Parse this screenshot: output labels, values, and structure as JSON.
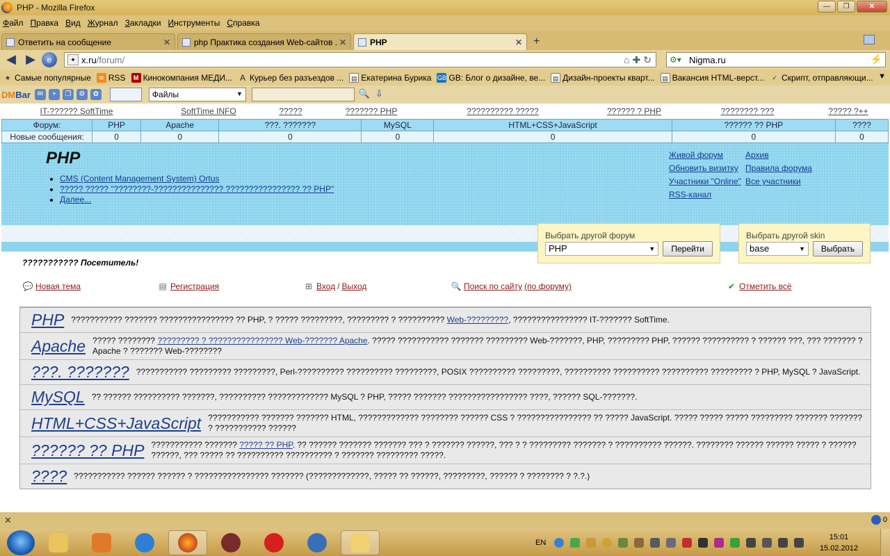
{
  "window": {
    "title": "PHP - Mozilla Firefox",
    "minimize": "—",
    "maximize": "❐",
    "close": "✕"
  },
  "menu": [
    "Файл",
    "Правка",
    "Вид",
    "Журнал",
    "Закладки",
    "Инструменты",
    "Справка"
  ],
  "tabs": [
    {
      "label": "Ответить на сообщение",
      "close": "✕"
    },
    {
      "label": "php Практика создания Web-сайтов ...",
      "close": "✕"
    },
    {
      "label": "PHP",
      "close": "✕"
    }
  ],
  "new_tab": "+",
  "navigation": {
    "back": "◀",
    "forward": "▶",
    "url_host": "x.ru",
    "url_path": "/forum/",
    "search_engine_value": "Nigma.ru"
  },
  "bookmarks": [
    {
      "icon": "star-icon",
      "label": "Самые популярные"
    },
    {
      "icon": "rss-icon",
      "label": "RSS"
    },
    {
      "icon": "m-icon",
      "label": "Кинокомпания МЕДИ..."
    },
    {
      "icon": "a-icon",
      "label": "Курьер без разъездов ..."
    },
    {
      "icon": "page-icon",
      "label": "Екатерина Бурика"
    },
    {
      "icon": "gb-icon",
      "label": "GB: Блог о дизайне, ве..."
    },
    {
      "icon": "page-icon",
      "label": "Дизайн-проекты кварт..."
    },
    {
      "icon": "page-icon",
      "label": "Вакансия HTML-верст..."
    },
    {
      "icon": "star-icon",
      "label": "Скрипт, отправляющи..."
    }
  ],
  "dmbar": {
    "logo_dm": "DM",
    "logo_bar": "Bar",
    "files_select": "Файлы"
  },
  "site_nav": [
    "IT-?????? SoftTime",
    "SoftTime INFO",
    "?????",
    "??????? PHP",
    "?????????? ?????",
    "?????? ? PHP",
    "???????? ???",
    "????? ?++"
  ],
  "stats": {
    "row1_label": "Форум:",
    "row2_label": "Новые сообщения:",
    "columns": [
      "PHP",
      "Apache",
      "???. ???????",
      "MySQL",
      "HTML+CSS+JavaScript",
      "?????? ?? PHP",
      "????"
    ],
    "counts": [
      "0",
      "0",
      "0",
      "0",
      "0",
      "0",
      "0"
    ]
  },
  "forum_header": {
    "title": "PHP",
    "topics": [
      "CMS (Content Management System) Ortus",
      "????? ????? \"????????-??????????????? ???????????????? ?? PHP\"",
      "Далее..."
    ],
    "links_col1": [
      "Живой форум",
      "Обновить визитку",
      "Участники \"Online\"",
      "RSS-канал"
    ],
    "links_col2": [
      "Архив",
      "Правила форума",
      "Все участники"
    ]
  },
  "forum_select": {
    "label": "Выбрать другой форум",
    "value": "PHP",
    "button": "Перейти"
  },
  "skin_select": {
    "label": "Выбрать другой skin",
    "value": "base",
    "button": "Выбрать"
  },
  "greeting": "??????????? Посетитель!",
  "actions": {
    "new_topic": "Новая тема",
    "register": "Регистрация",
    "login": "Вход",
    "logout": "Выход",
    "slash": "/",
    "search": "Поиск по сайту",
    "search_forum": "(по форуму)",
    "mark_all": "Отметить всё"
  },
  "forums": [
    {
      "name": "PHP",
      "desc_before": "??????????? ??????? ???????????????? ?? PHP, ? ????? ?????????, ????????? ? ?????????? ",
      "link": "Web-?????????",
      "desc_after": ", ???????????????? IT-??????? SoftTime."
    },
    {
      "name": "Apache",
      "desc_before": "????? ???????? ",
      "link": "????????? ? ???????????????? Web-??????? Apache",
      "desc_after": ". ????? ??????????? ??????? ????????? Web-???????, PHP, ????????? PHP, ?????? ?????????? ? ?????? ???, ??? ??????? ? Apache ? ??????? Web-????????"
    },
    {
      "name": "???. ???????",
      "desc_before": "??????????? ????????? ?????????, Perl-?????????? ?????????? ?????????, POSIX ?????????? ?????????, ?????????? ?????????? ?????????? ????????? ? PHP, MySQL ? JavaScript.",
      "link": "",
      "desc_after": ""
    },
    {
      "name": "MySQL",
      "desc_before": "?? ?????? ?????????? ???????, ?????????? ????????????? MySQL ? PHP, ????? ??????? ????????????????? ????, ?????? SQL-???????.",
      "link": "",
      "desc_after": ""
    },
    {
      "name": "HTML+CSS+JavaScript",
      "desc_before": "??????????? ??????? ??????? HTML, ????????????? ???????? ?????? CSS ? ???????????????? ?? ????? JavaScript. ????? ????? ????? ????????? ??????? ??????? ? ??????????? ??????",
      "link": "",
      "desc_after": ""
    },
    {
      "name": "?????? ?? PHP",
      "desc_before": "??????????? ??????? ",
      "link": "????? ?? PHP",
      "desc_after": ". ?? ?????? ??????? ??????? ??? ? ??????? ??????, ??? ? ? ????????? ??????? ? ?????????? ??????. ???????? ?????? ?????? ????? ? ?????? ??????, ??? ????? ?? ?????????? ?????????? ? ??????? ????????? ?????."
    },
    {
      "name": "????",
      "desc_before": "??????????? ?????? ?????? ? ???????????????? ??????? (?????????????, ????? ?? ??????, ?????????, ?????? ? ???????? ? ?.?.)",
      "link": "",
      "desc_after": ""
    }
  ],
  "statusbar": {
    "close": "✕",
    "count": "0"
  },
  "taskbar": {
    "lang": "EN",
    "time": "15:01",
    "date": "15.02.2012"
  },
  "colors": {
    "titlebar": "#d7b45e",
    "header_blue": "#8fd4ee",
    "link_blue": "#1e3f8f",
    "action_red": "#8b1a1a"
  }
}
